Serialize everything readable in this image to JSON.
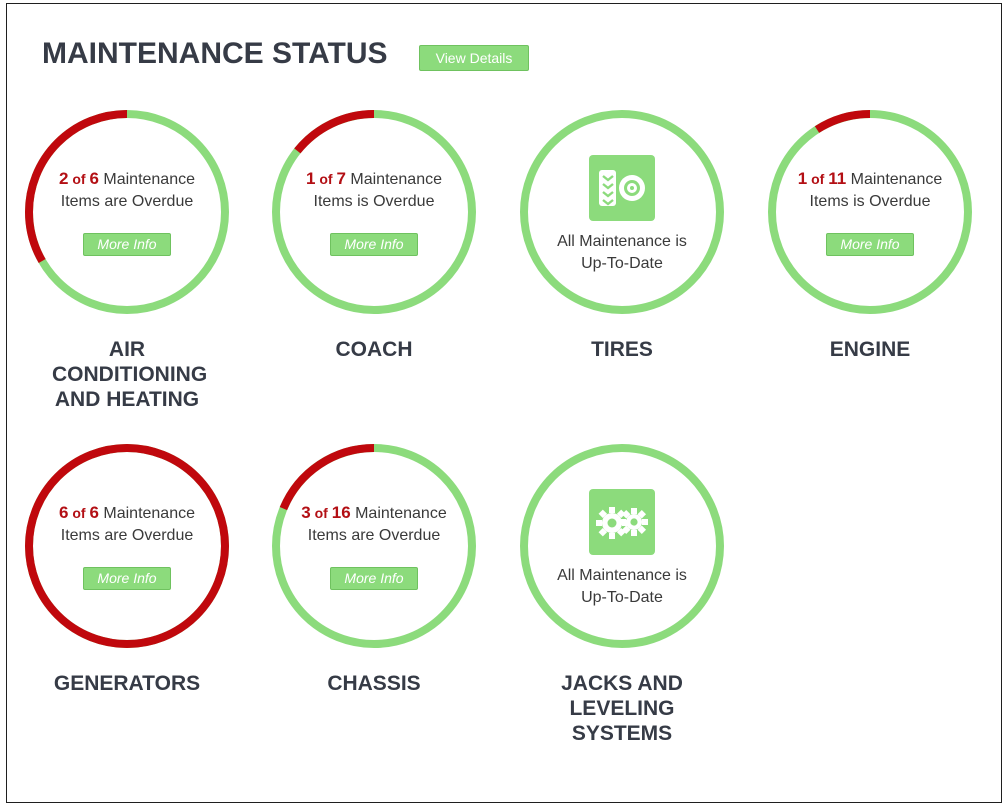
{
  "header": {
    "title": "MAINTENANCE STATUS",
    "view_details": "View Details"
  },
  "colors": {
    "ok": "#8cdb7c",
    "overdue": "#c0080d",
    "text": "#363b46",
    "count": "#b30f14"
  },
  "more_info_label": "More Info",
  "systems": [
    {
      "name": "AIR CONDITIONING AND HEATING",
      "overdue": 2,
      "total": 6,
      "status_text": "Items are Overdue"
    },
    {
      "name": "COACH",
      "overdue": 1,
      "total": 7,
      "status_text": "Items is Overdue"
    },
    {
      "name": "TIRES",
      "overdue": 0,
      "total": null,
      "status_text": "All Maintenance is Up-To-Date",
      "icon": "tire-icon"
    },
    {
      "name": "ENGINE",
      "overdue": 1,
      "total": 11,
      "status_text": "Items is Overdue"
    },
    {
      "name": "GENERATORS",
      "overdue": 6,
      "total": 6,
      "status_text": "Items are Overdue"
    },
    {
      "name": "CHASSIS",
      "overdue": 3,
      "total": 16,
      "status_text": "Items are Overdue"
    },
    {
      "name": "JACKS AND LEVELING SYSTEMS",
      "overdue": 0,
      "total": null,
      "status_text": "All Maintenance is Up-To-Date",
      "icon": "gears-icon"
    }
  ]
}
